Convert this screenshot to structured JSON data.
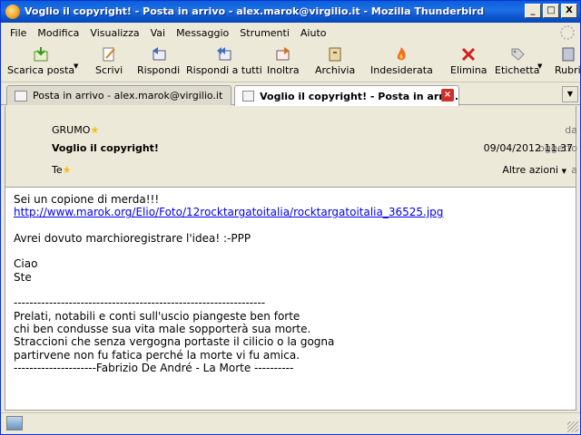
{
  "window": {
    "title": "Voglio il copyright! - Posta in arrivo - alex.marok@virgilio.it - Mozilla Thunderbird",
    "minimize": "_",
    "maximize": "□",
    "close": "X"
  },
  "menu": [
    "File",
    "Modifica",
    "Visualizza",
    "Vai",
    "Messaggio",
    "Strumenti",
    "Aiuto"
  ],
  "toolbar": {
    "get_mail": "Scarica posta",
    "write": "Scrivi",
    "reply": "Rispondi",
    "reply_all": "Rispondi a tutti",
    "forward": "Inoltra",
    "archive": "Archivia",
    "junk": "Indesiderata",
    "delete": "Elimina",
    "tag": "Etichetta",
    "trash": "Rubri"
  },
  "tabs": {
    "inbox": "Posta in arrivo - alex.marok@virgilio.it",
    "message": "Voglio il copyright! - Posta in arri..."
  },
  "header": {
    "from_label": "da",
    "from_value": "GRUMO",
    "subject_label": "oggetto",
    "subject_value": "Voglio il copyright!",
    "date": "09/04/2012 11.37",
    "to_label": "a",
    "to_value": "Te",
    "other_actions": "Altre azioni"
  },
  "message": {
    "line1": "Sei un copione di merda!!!",
    "link": "http://www.marok.org/Elio/Foto/12rocktargatoitalia/rocktargatoitalia_36525.jpg",
    "line3": "Avrei dovuto marchioregistrare l'idea! :-PPP",
    "line4": "Ciao",
    "line5": "Ste",
    "separator": "----------------------------------------------------------------",
    "poem1": "Prelati, notabili e conti sull'uscio piangeste ben forte",
    "poem2": "chi ben condusse sua vita male sopporterà sua morte.",
    "poem3": "Straccioni che senza vergogna portaste il cilicio o la gogna",
    "poem4": "partirvene non fu fatica perché la morte vi fu amica.",
    "signature": "---------------------Fabrizio De André - La Morte ----------"
  }
}
